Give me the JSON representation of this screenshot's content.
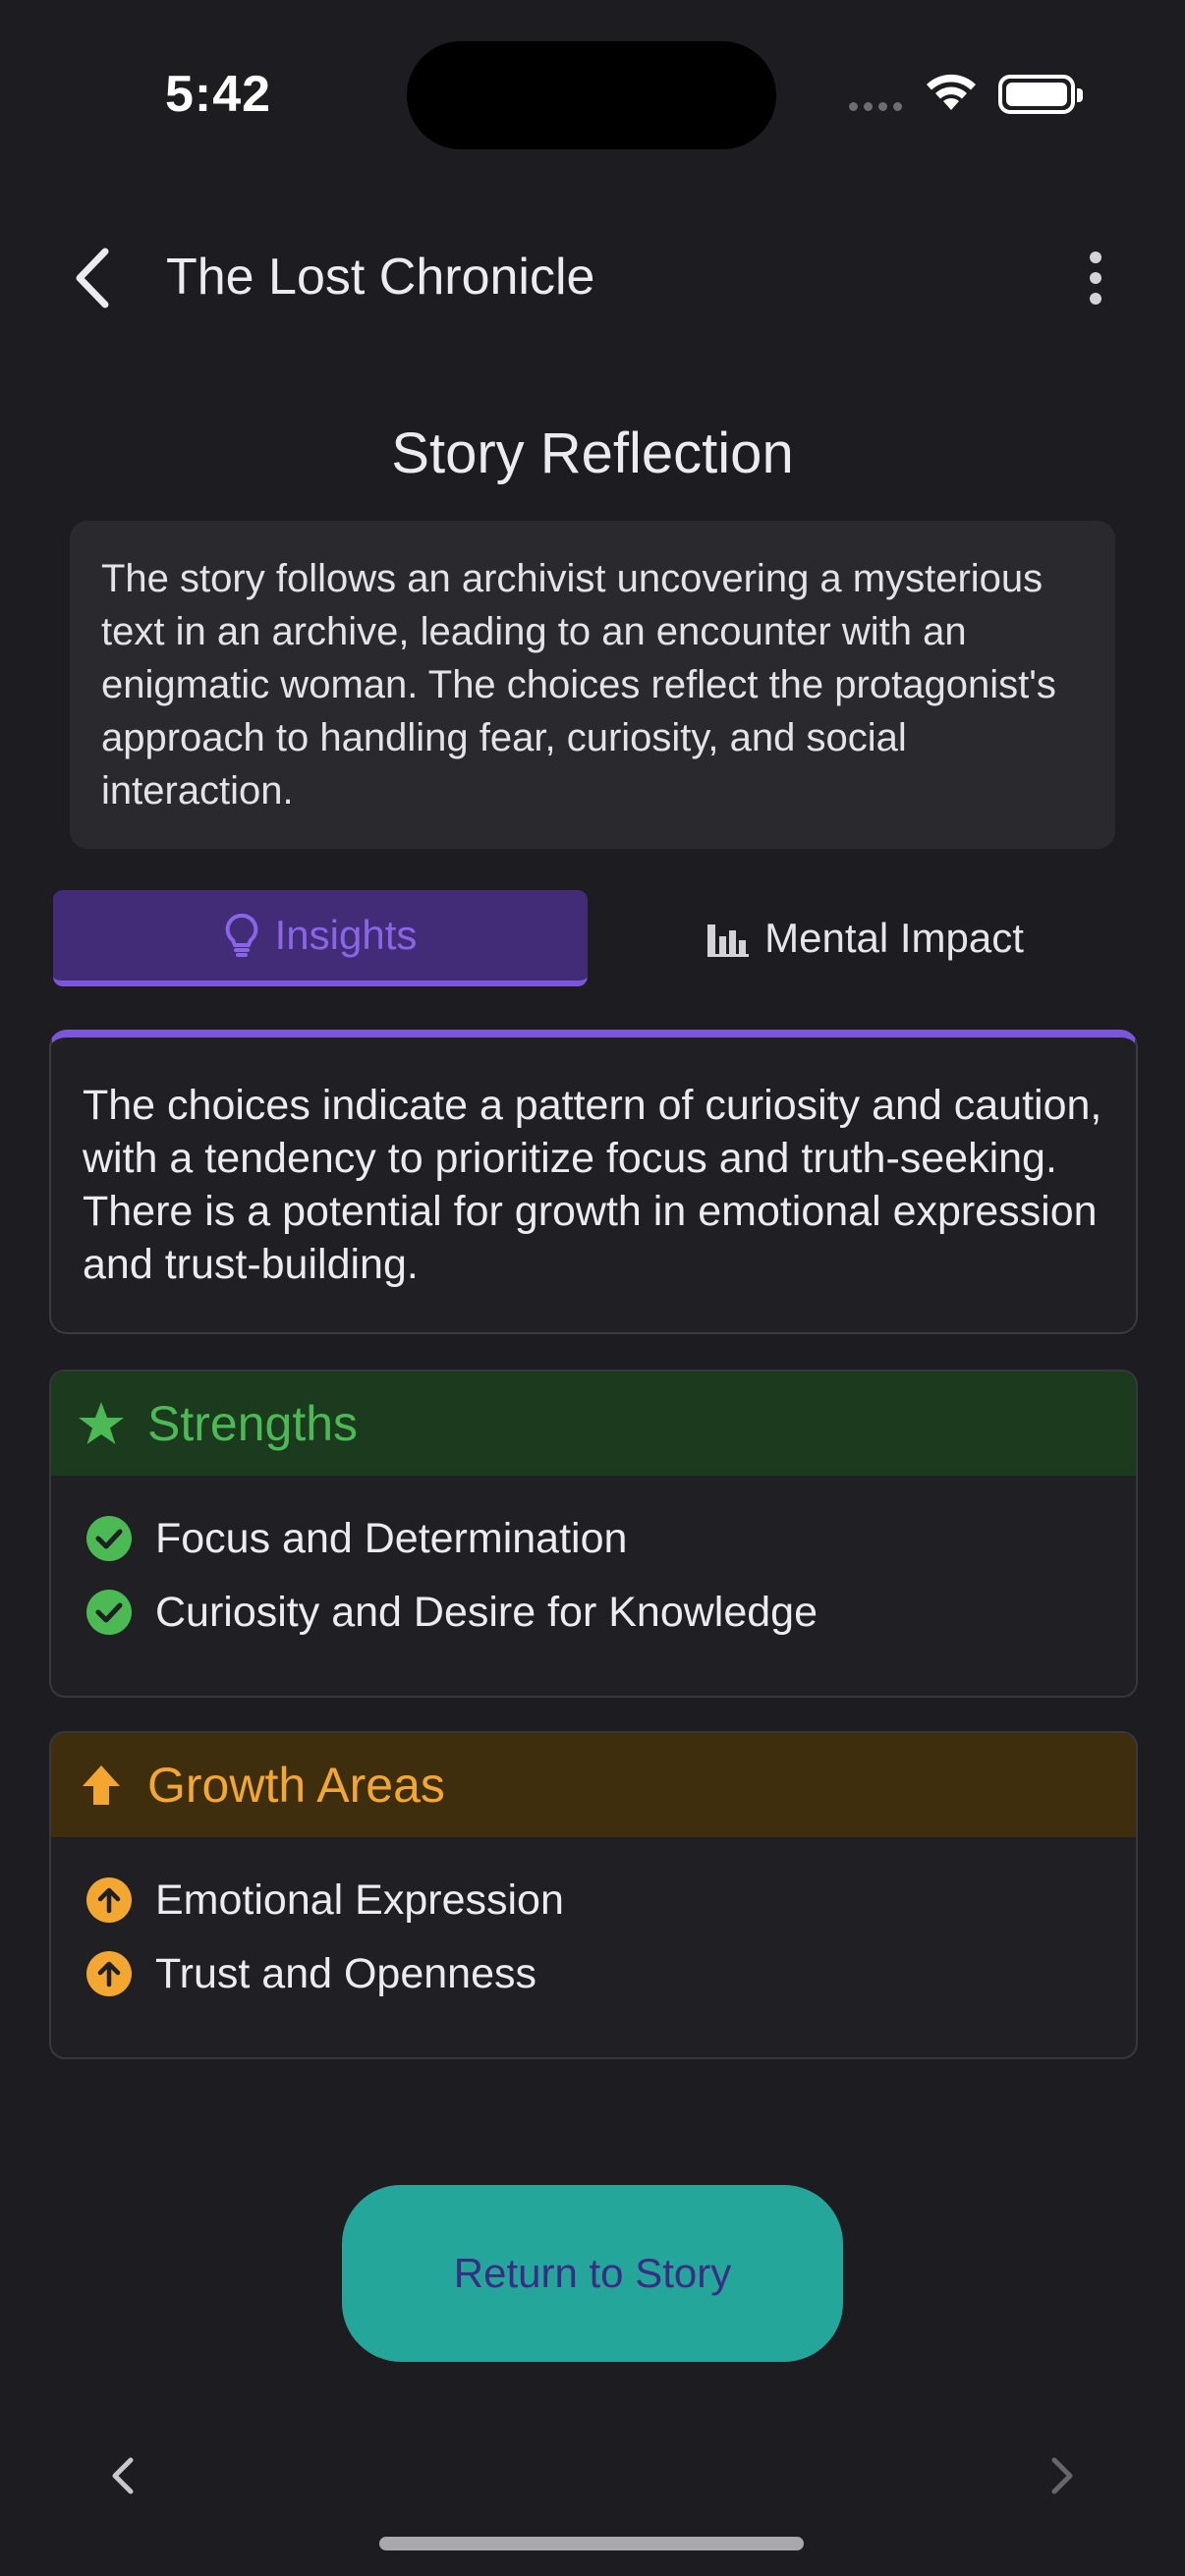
{
  "status_bar": {
    "time": "5:42"
  },
  "app_bar": {
    "title": "The Lost Chronicle"
  },
  "page": {
    "section_title": "Story Reflection",
    "summary": "The story follows an archivist uncovering a mysterious text in an archive, leading to an encounter with an enigmatic woman. The choices reflect the protagonist's approach to handling fear, curiosity, and social interaction."
  },
  "tabs": [
    {
      "label": "Insights",
      "icon": "lightbulb-icon",
      "selected": true
    },
    {
      "label": "Mental Impact",
      "icon": "bar-chart-icon",
      "selected": false
    }
  ],
  "insight": {
    "text": "The choices indicate a pattern of curiosity and caution, with a tendency to prioritize focus and truth-seeking. There is a potential for growth in emotional expression and trust-building."
  },
  "strengths": {
    "title": "Strengths",
    "icon": "star-icon",
    "items": [
      "Focus and Determination",
      "Curiosity and Desire for Knowledge"
    ]
  },
  "growth_areas": {
    "title": "Growth Areas",
    "icon": "arrow-up-icon",
    "items": [
      "Emotional Expression",
      "Trust and Openness"
    ]
  },
  "actions": {
    "return_label": "Return to Story"
  },
  "colors": {
    "accent_purple": "#7c55d8",
    "strength_green": "#4cba54",
    "growth_orange": "#f3a630",
    "button_teal": "#25a69a"
  }
}
